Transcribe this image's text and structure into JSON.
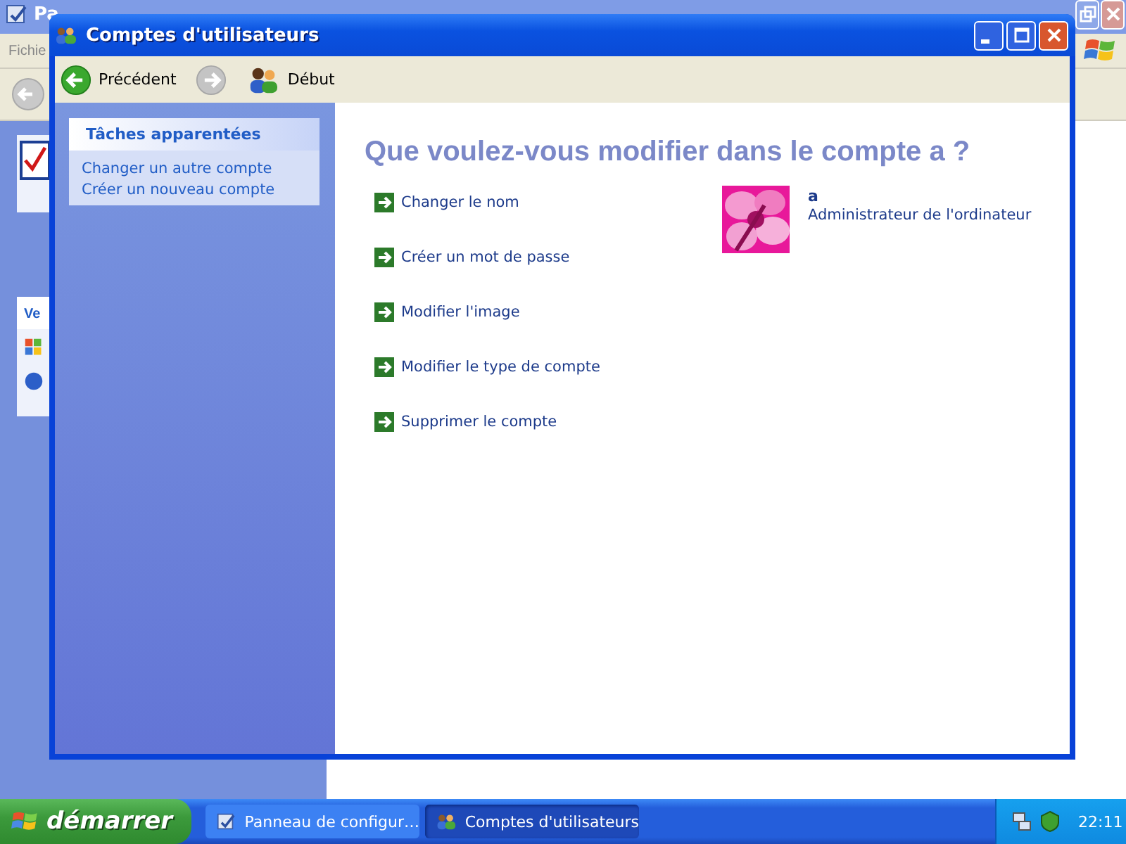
{
  "background_window": {
    "title": "Pa",
    "menu": [
      "Fichie"
    ],
    "panel_header": "Ve"
  },
  "window": {
    "title": "Comptes d'utilisateurs"
  },
  "toolbar": [
    {
      "kind": "back",
      "label": "Précédent",
      "disabled": false
    },
    {
      "kind": "forward",
      "disabled": true
    },
    {
      "kind": "home",
      "label": "Début"
    }
  ],
  "tasks": {
    "title": "Tâches apparentées",
    "links": [
      "Changer un autre compte",
      "Créer un nouveau compte"
    ]
  },
  "heading": "Que voulez-vous modifier dans le compte a ?",
  "actions": [
    "Changer le nom",
    "Créer un mot de passe",
    "Modifier l'image",
    "Modifier le type de compte",
    "Supprimer le compte"
  ],
  "account": {
    "name": "a",
    "type": "Administrateur de l'ordinateur"
  },
  "taskbar": {
    "start": "démarrer",
    "tasks": [
      {
        "kind": "control-panel",
        "label": "Panneau de configur…",
        "selected": false
      },
      {
        "kind": "users",
        "label": "Comptes d'utilisateurs",
        "selected": true
      }
    ],
    "time": "22:11"
  }
}
